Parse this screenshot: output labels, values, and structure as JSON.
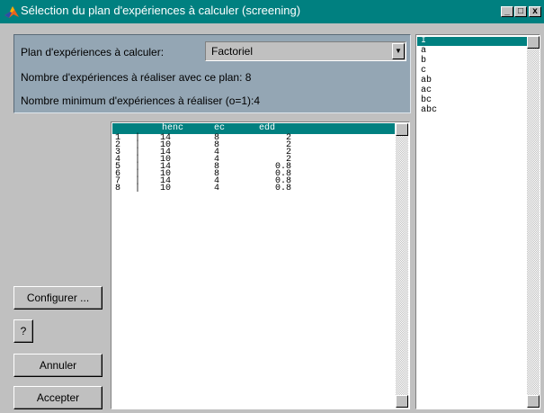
{
  "window": {
    "title": "Sélection du plan d'expériences à calculer (screening)",
    "controls": {
      "minimize": "_",
      "maximize": "□",
      "close": "x"
    }
  },
  "panel": {
    "plan_label": "Plan d'expériences à calculer:",
    "plan_value": "Factoriel",
    "count_label": "Nombre d'expériences à réaliser avec ce plan: 8",
    "min_label": "Nombre minimum d'expériences à réaliser (o=1):4"
  },
  "table": {
    "headers": [
      "henc",
      "ec",
      "edd"
    ],
    "rows": [
      {
        "n": "1",
        "sep": "|",
        "henc": "14",
        "ec": "8",
        "edd": "2"
      },
      {
        "n": "2",
        "sep": "|",
        "henc": "10",
        "ec": "8",
        "edd": "2"
      },
      {
        "n": "3",
        "sep": "|",
        "henc": "14",
        "ec": "4",
        "edd": "2"
      },
      {
        "n": "4",
        "sep": "|",
        "henc": "10",
        "ec": "4",
        "edd": "2"
      },
      {
        "n": "5",
        "sep": "|",
        "henc": "14",
        "ec": "8",
        "edd": "0.8"
      },
      {
        "n": "6",
        "sep": "|",
        "henc": "10",
        "ec": "8",
        "edd": "0.8"
      },
      {
        "n": "7",
        "sep": "|",
        "henc": "14",
        "ec": "4",
        "edd": "0.8"
      },
      {
        "n": "8",
        "sep": "|",
        "henc": "10",
        "ec": "4",
        "edd": "0.8"
      }
    ]
  },
  "effects": [
    "I",
    "a",
    "b",
    "c",
    "ab",
    "ac",
    "bc",
    "abc"
  ],
  "buttons": {
    "configure": "Configurer ...",
    "help": "?",
    "cancel": "Annuler",
    "accept": "Accepter"
  },
  "colors": {
    "titlebar": "#008080",
    "panel": "#94a6b4",
    "face": "#c0c0c0",
    "selection": "#008080"
  }
}
